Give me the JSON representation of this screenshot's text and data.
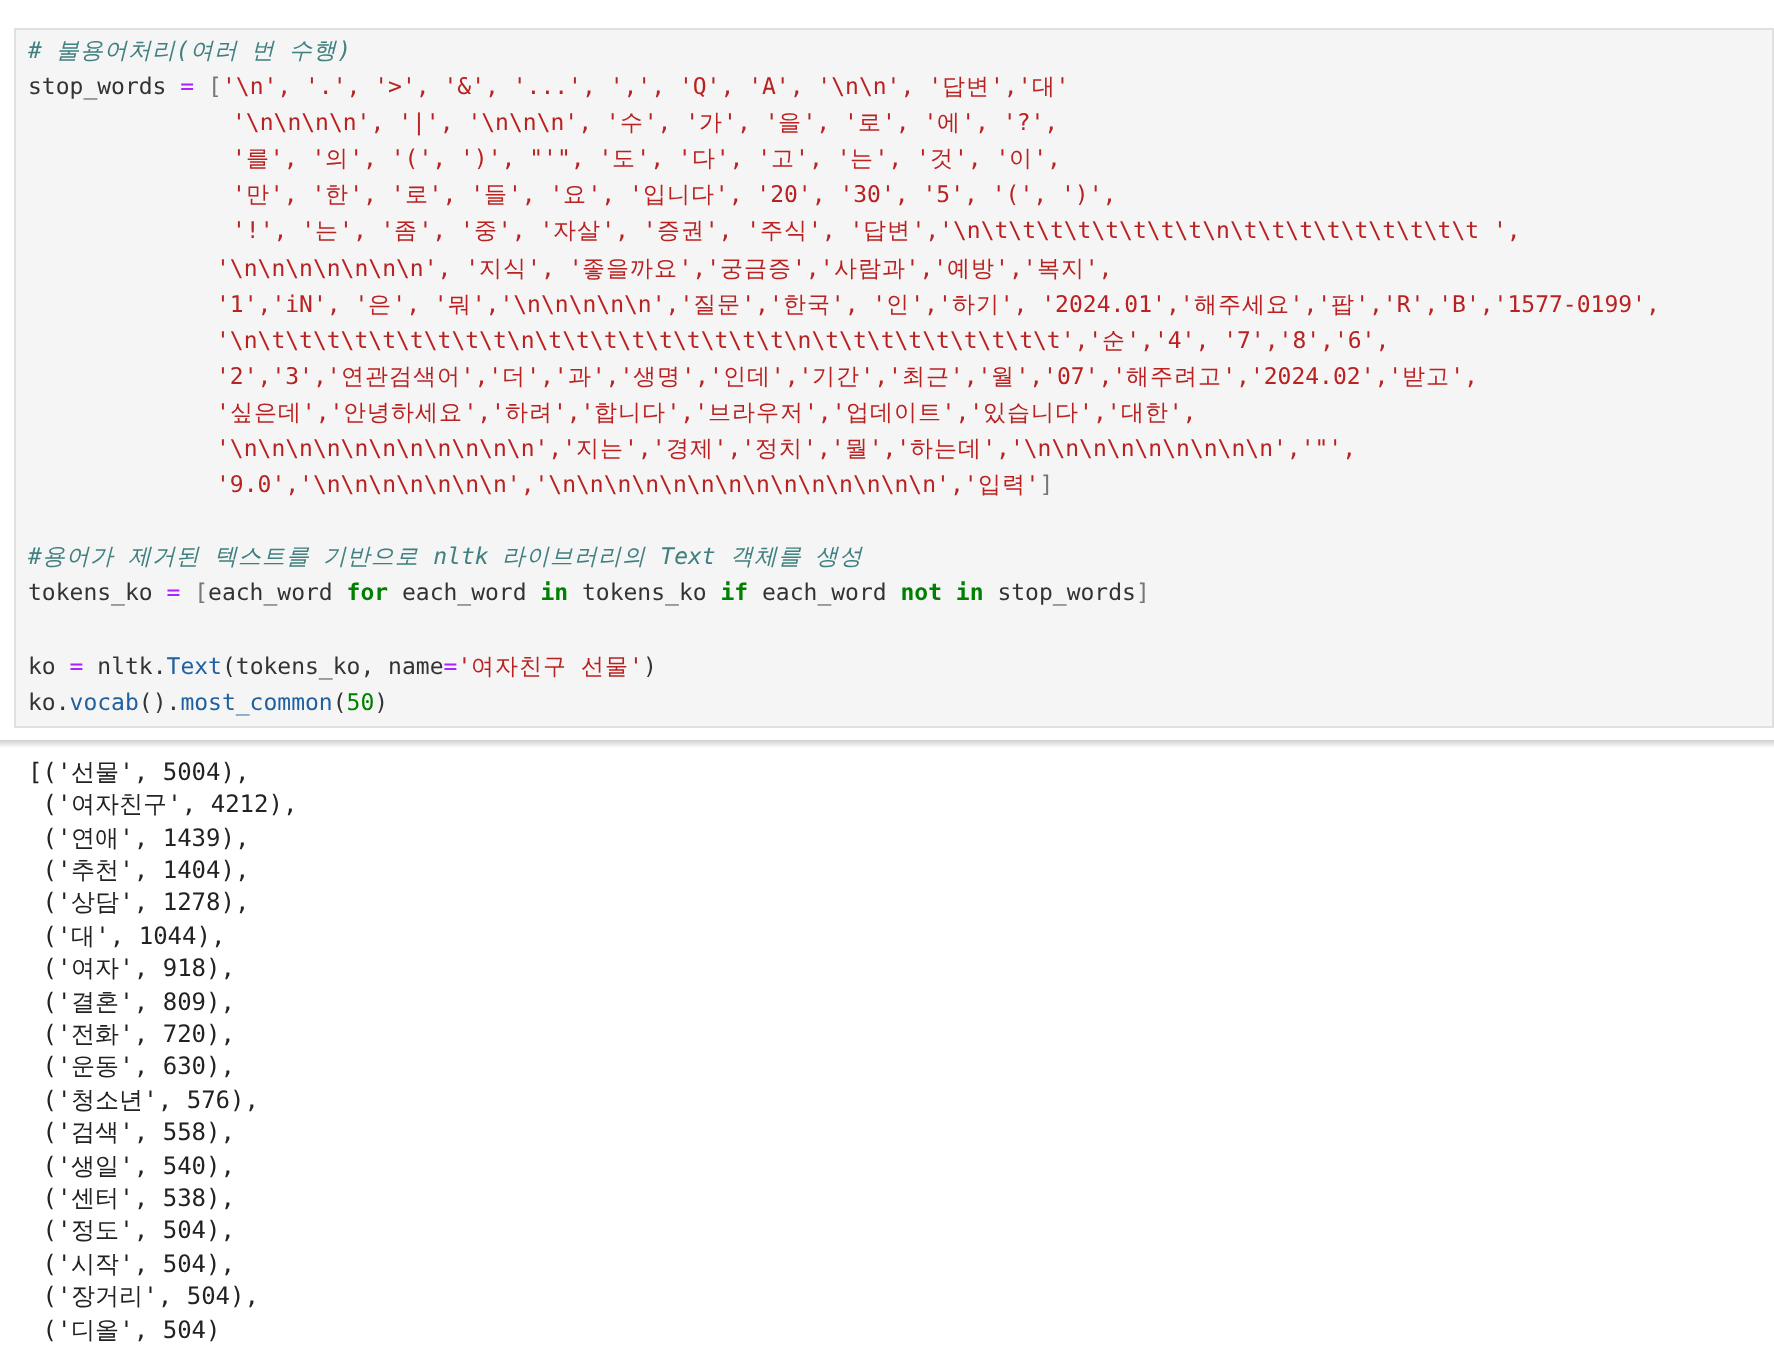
{
  "code_cell": {
    "lines": [
      {
        "tokens": [
          {
            "kind": "comment",
            "text": "# 불용어처리(여러 번 수행)"
          }
        ]
      },
      {
        "tokens": [
          {
            "kind": "name",
            "text": "stop_words"
          },
          {
            "kind": "op",
            "text": " = "
          },
          {
            "kind": "bracket",
            "text": "["
          },
          {
            "kind": "string",
            "text": "'\\n', '.', '>', '&', '...', ',', 'Q', 'A', '\\n\\n', '답변','대'"
          }
        ]
      },
      {
        "kind": "deep",
        "tokens": [
          {
            "kind": "string",
            "text": "'\\n\\n\\n\\n', '|', '\\n\\n\\n', '수', '가', '을', '로', '에', '?',"
          }
        ]
      },
      {
        "kind": "deep",
        "tokens": [
          {
            "kind": "string",
            "text": "'를', '의', '(', ')', \"'\", '도', '다', '고', '는', '것', '이',"
          }
        ]
      },
      {
        "kind": "deep",
        "tokens": [
          {
            "kind": "string",
            "text": "'만', '한', '로', '들', '요', '입니다', '20', '30', '5', '(', ')',"
          }
        ]
      },
      {
        "kind": "deep",
        "tokens": [
          {
            "kind": "string",
            "text": "'!', '는', '좀', '중', '자살', '증권', '주식', '답변','\\n\\t\\t\\t\\t\\t\\t\\t\\t\\n\\t\\t\\t\\t\\t\\t\\t\\t\\t ',"
          }
        ]
      },
      {
        "kind": "shallow",
        "tokens": [
          {
            "kind": "string",
            "text": "'\\n\\n\\n\\n\\n\\n\\n', '지식', '좋을까요','궁금증','사람과','예방','복지',"
          }
        ]
      },
      {
        "kind": "shallow",
        "tokens": [
          {
            "kind": "string",
            "text": "'1','iN', '은', '뭐','\\n\\n\\n\\n\\n','질문','한국', '인','하기', '2024.01','해주세요','팝','R','B','1577-0199',"
          }
        ]
      },
      {
        "kind": "shallow",
        "tokens": [
          {
            "kind": "string",
            "text": "'\\n\\t\\t\\t\\t\\t\\t\\t\\t\\t\\n\\t\\t\\t\\t\\t\\t\\t\\t\\t\\n\\t\\t\\t\\t\\t\\t\\t\\t\\t','순','4', '7','8','6',"
          }
        ]
      },
      {
        "kind": "shallow",
        "tokens": [
          {
            "kind": "string",
            "text": "'2','3','연관검색어','더','과','생명','인데','기간','최근','월','07','해주려고','2024.02','받고',"
          }
        ]
      },
      {
        "kind": "shallow",
        "tokens": [
          {
            "kind": "string",
            "text": "'싶은데','안녕하세요','하려','합니다','브라우저','업데이트','있습니다','대한',"
          }
        ]
      },
      {
        "kind": "shallow",
        "tokens": [
          {
            "kind": "string",
            "text": "'\\n\\n\\n\\n\\n\\n\\n\\n\\n\\n\\n','지는','경제','정치','뭘','하는데','\\n\\n\\n\\n\\n\\n\\n\\n\\n','\"',"
          }
        ]
      },
      {
        "kind": "shallow",
        "tokens": [
          {
            "kind": "string",
            "text": "'9.0','\\n\\n\\n\\n\\n\\n\\n','\\n\\n\\n\\n\\n\\n\\n\\n\\n\\n\\n\\n\\n\\n','입력'"
          },
          {
            "kind": "bracket",
            "text": "]"
          }
        ]
      },
      {
        "gap_before": true,
        "tokens": [
          {
            "kind": "comment",
            "text": "#용어가 제거된 텍스트를 기반으로 nltk 라이브러리의 Text 객체를 생성"
          }
        ]
      },
      {
        "tokens": [
          {
            "kind": "name",
            "text": "tokens_ko"
          },
          {
            "kind": "op",
            "text": " = "
          },
          {
            "kind": "bracket",
            "text": "["
          },
          {
            "kind": "name",
            "text": "each_word"
          },
          {
            "kind": "keyword",
            "text": " for "
          },
          {
            "kind": "name",
            "text": "each_word"
          },
          {
            "kind": "keyword",
            "text": " in "
          },
          {
            "kind": "name",
            "text": "tokens_ko"
          },
          {
            "kind": "keyword",
            "text": " if "
          },
          {
            "kind": "name",
            "text": "each_word"
          },
          {
            "kind": "keyword",
            "text": " not in "
          },
          {
            "kind": "name",
            "text": "stop_words"
          },
          {
            "kind": "bracket",
            "text": "]"
          }
        ]
      },
      {
        "gap_before": true,
        "tokens": [
          {
            "kind": "name",
            "text": "ko"
          },
          {
            "kind": "op",
            "text": " = "
          },
          {
            "kind": "name",
            "text": "nltk."
          },
          {
            "kind": "attr",
            "text": "Text"
          },
          {
            "kind": "name",
            "text": "(tokens_ko, name"
          },
          {
            "kind": "op",
            "text": "="
          },
          {
            "kind": "string",
            "text": "'여자친구 선물'"
          },
          {
            "kind": "name",
            "text": ")"
          }
        ]
      },
      {
        "tokens": [
          {
            "kind": "name",
            "text": "ko."
          },
          {
            "kind": "attr",
            "text": "vocab"
          },
          {
            "kind": "name",
            "text": "()."
          },
          {
            "kind": "attr",
            "text": "most_common"
          },
          {
            "kind": "name",
            "text": "("
          },
          {
            "kind": "number",
            "text": "50"
          },
          {
            "kind": "name",
            "text": ")"
          }
        ]
      }
    ]
  },
  "output": {
    "lines": [
      "[('선물', 5004),",
      " ('여자친구', 4212),",
      " ('연애', 1439),",
      " ('추천', 1404),",
      " ('상담', 1278),",
      " ('대', 1044),",
      " ('여자', 918),",
      " ('결혼', 809),",
      " ('전화', 720),",
      " ('운동', 630),",
      " ('청소년', 576),",
      " ('검색', 558),",
      " ('생일', 540),",
      " ('센터', 538),",
      " ('정도', 504),",
      " ('시작', 504),",
      " ('장거리', 504),",
      " ('디올', 504)"
    ]
  }
}
